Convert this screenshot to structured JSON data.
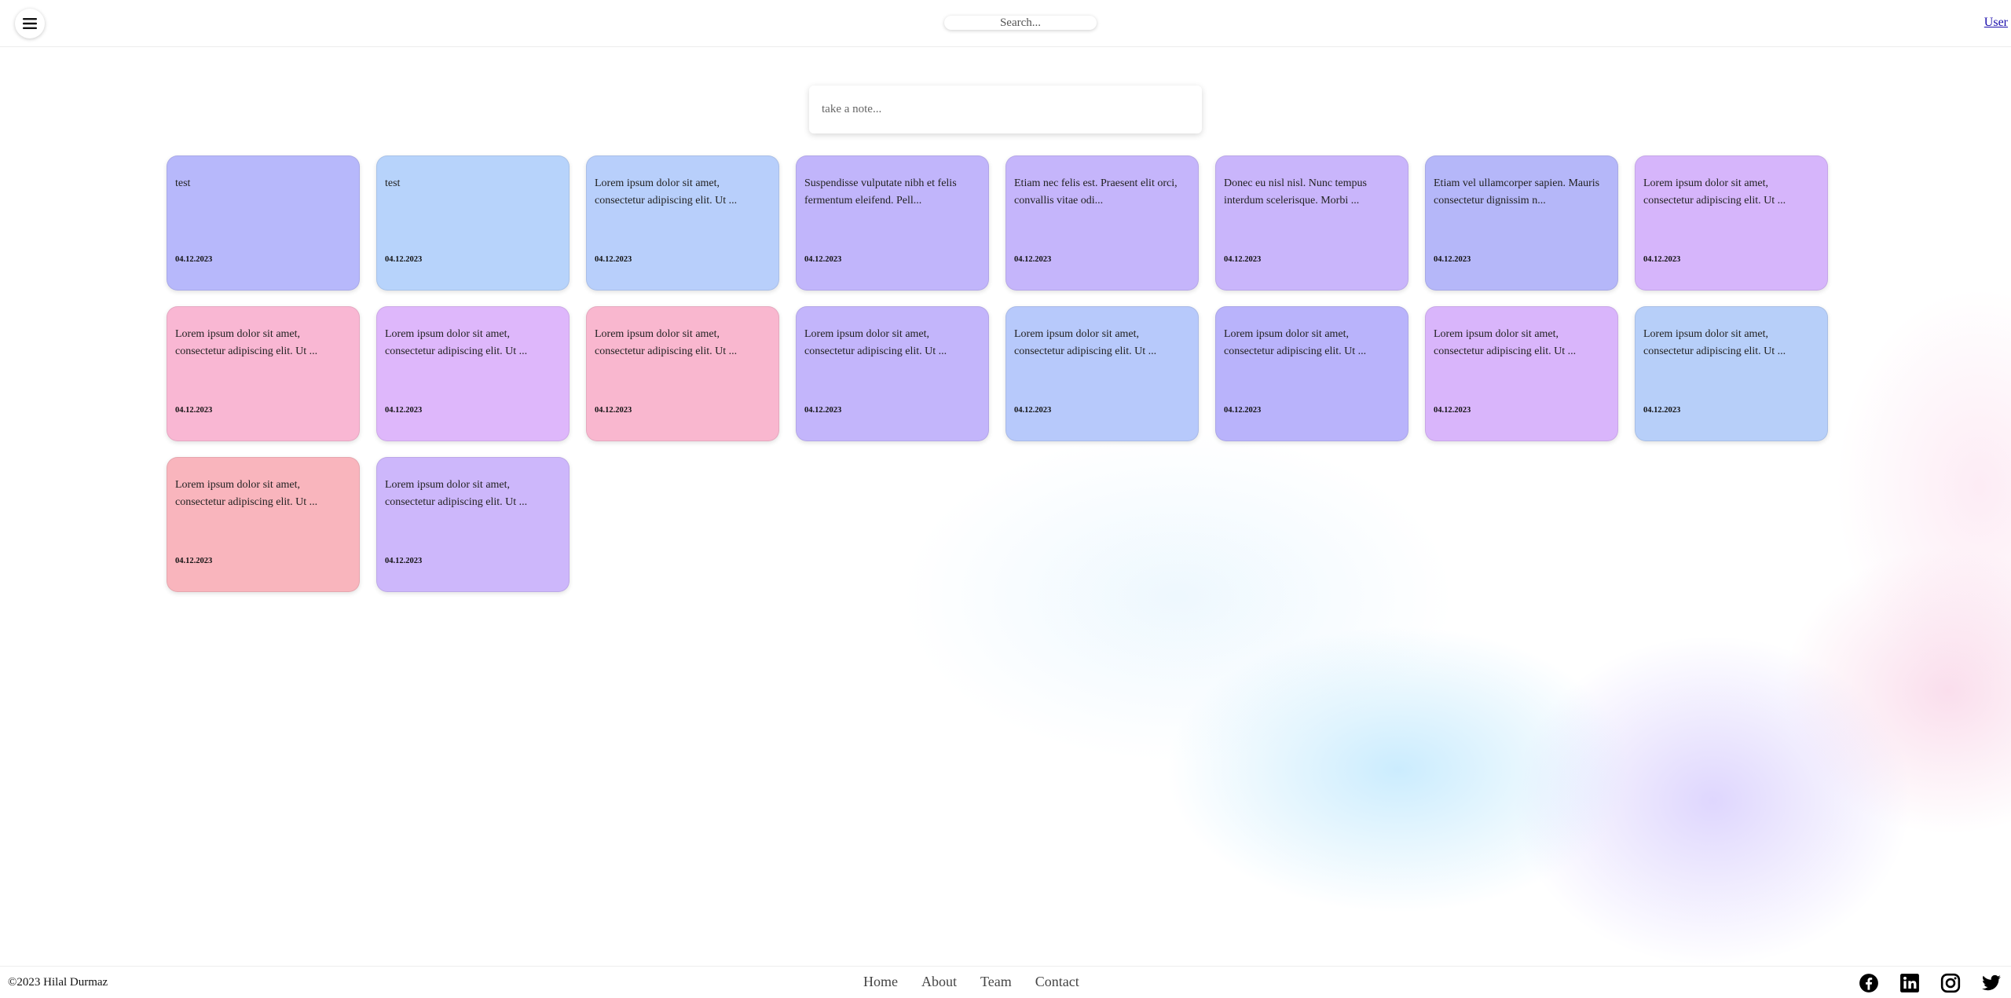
{
  "header": {
    "menu_icon": "hamburger-menu-icon",
    "search_placeholder": "Search...",
    "user_label": "User"
  },
  "composer": {
    "placeholder": "take a note..."
  },
  "notes": [
    {
      "text": "test",
      "date": "04.12.2023",
      "color": "#b7b8fb"
    },
    {
      "text": "test",
      "date": "04.12.2023",
      "color": "#b7d3fb"
    },
    {
      "text": "Lorem ipsum dolor sit amet, consectetur adipiscing elit. Ut ...",
      "date": "04.12.2023",
      "color": "#b8cffb"
    },
    {
      "text": "Suspendisse vulputate nibh et felis fermentum eleifend. Pell...",
      "date": "04.12.2023",
      "color": "#c1b5fb"
    },
    {
      "text": "Etiam nec felis est. Praesent elit orci, convallis vitae odi...",
      "date": "04.12.2023",
      "color": "#c5b5fb"
    },
    {
      "text": "Donec eu nisl nisl. Nunc tempus interdum scelerisque. Morbi ...",
      "date": "04.12.2023",
      "color": "#c9b5fb"
    },
    {
      "text": "Etiam vel ullamcorper sapien. Mauris consectetur dignissim n...",
      "date": "04.12.2023",
      "color": "#b5b7f9"
    },
    {
      "text": "Lorem ipsum dolor sit amet, consectetur adipiscing elit. Ut ...",
      "date": "04.12.2023",
      "color": "#d6b5fb"
    },
    {
      "text": "Lorem ipsum dolor sit amet, consectetur adipiscing elit. Ut ...",
      "date": "04.12.2023",
      "color": "#f9b7d3"
    },
    {
      "text": "Lorem ipsum dolor sit amet, consectetur adipiscing elit. Ut ...",
      "date": "04.12.2023",
      "color": "#deb7fb"
    },
    {
      "text": "Lorem ipsum dolor sit amet, consectetur adipiscing elit. Ut ...",
      "date": "04.12.2023",
      "color": "#f9b7cf"
    },
    {
      "text": "Lorem ipsum dolor sit amet, consectetur adipiscing elit. Ut ...",
      "date": "04.12.2023",
      "color": "#c3b5fb"
    },
    {
      "text": "Lorem ipsum dolor sit amet, consectetur adipiscing elit. Ut ...",
      "date": "04.12.2023",
      "color": "#b7c9fb"
    },
    {
      "text": "Lorem ipsum dolor sit amet, consectetur adipiscing elit. Ut ...",
      "date": "04.12.2023",
      "color": "#b9b3fb"
    },
    {
      "text": "Lorem ipsum dolor sit amet, consectetur adipiscing elit. Ut ...",
      "date": "04.12.2023",
      "color": "#d9b5fb"
    },
    {
      "text": "Lorem ipsum dolor sit amet, consectetur adipiscing elit. Ut ...",
      "date": "04.12.2023",
      "color": "#b7cff9"
    },
    {
      "text": "Lorem ipsum dolor sit amet, consectetur adipiscing elit. Ut ...",
      "date": "04.12.2023",
      "color": "#f9b5bd"
    },
    {
      "text": "Lorem ipsum dolor sit amet, consectetur adipiscing elit. Ut ...",
      "date": "04.12.2023",
      "color": "#cdb7fb"
    }
  ],
  "footer": {
    "copyright": "©2023 Hilal Durmaz",
    "nav": [
      "Home",
      "About",
      "Team",
      "Contact"
    ],
    "social_icons": [
      "facebook-icon",
      "linkedin-icon",
      "instagram-icon",
      "twitter-icon"
    ]
  }
}
